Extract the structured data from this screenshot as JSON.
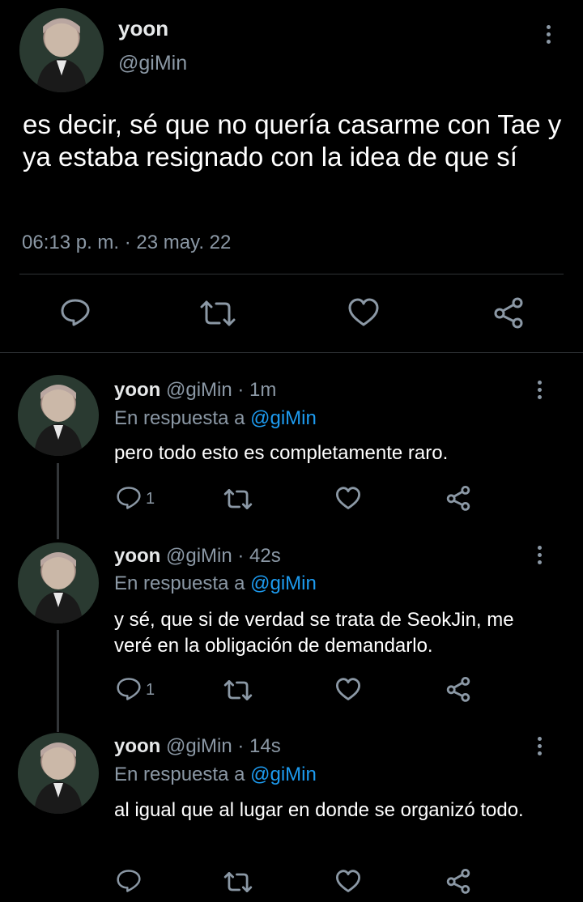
{
  "main_tweet": {
    "name": "yoon",
    "handle": "@giMin",
    "text": "es decir, sé que no quería casarme con Tae y ya estaba resignado con la idea de que sí",
    "timestamp": "06:13 p. m. · 23 may. 22",
    "actions": [
      "comment-icon",
      "retweet-icon",
      "heart-icon",
      "share-icon"
    ]
  },
  "replies": [
    {
      "name": "yoon",
      "handle_time": "@giMin · 1m",
      "in_reply_prefix": "En respuesta a",
      "in_reply_handle": "@giMin",
      "text": "pero todo esto es completamente raro.",
      "reply_count": "1"
    },
    {
      "name": "yoon",
      "handle_time": "@giMin · 42s",
      "in_reply_prefix": "En respuesta a",
      "in_reply_handle": "@giMin",
      "text": "y sé, que si de verdad se trata de SeokJin, me veré en la obligación de demandarlo.",
      "reply_count": "1"
    },
    {
      "name": "yoon",
      "handle_time": "@giMin · 14s",
      "in_reply_prefix": "En respuesta a",
      "in_reply_handle": "@giMin",
      "text": "al igual que al lugar en donde se organizó todo.",
      "reply_count": ""
    }
  ],
  "colors": {
    "background": "#000000",
    "text": "#e7e9ea",
    "muted": "#8b98a5",
    "link": "#1d9bf0",
    "divider": "#2f3336"
  }
}
